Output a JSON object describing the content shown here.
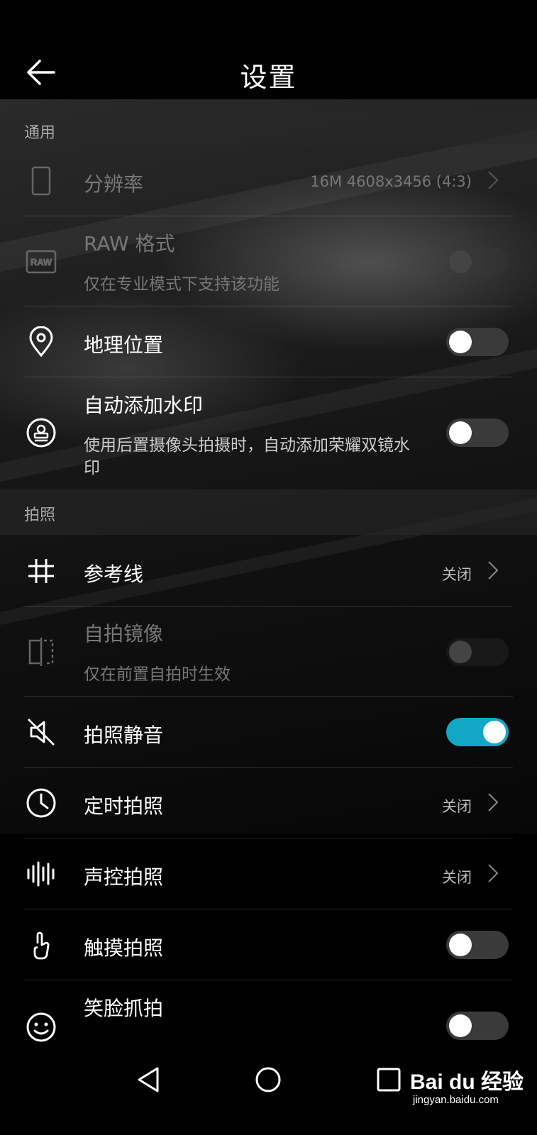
{
  "header": {
    "title": "设置"
  },
  "sections": {
    "general": "通用",
    "photo": "拍照"
  },
  "rows": {
    "resolution": {
      "label": "分辨率",
      "value": "16M 4608x3456 (4:3)"
    },
    "raw": {
      "label": "RAW 格式",
      "sub": "仅在专业模式下支持该功能"
    },
    "location": {
      "label": "地理位置"
    },
    "watermark": {
      "label": "自动添加水印",
      "sub": "使用后置摄像头拍摄时，自动添加荣耀双镜水印"
    },
    "grid": {
      "label": "参考线",
      "value": "关闭"
    },
    "mirror": {
      "label": "自拍镜像",
      "sub": "仅在前置自拍时生效"
    },
    "mute": {
      "label": "拍照静音"
    },
    "timer": {
      "label": "定时拍照",
      "value": "关闭"
    },
    "voice": {
      "label": "声控拍照",
      "value": "关闭"
    },
    "touch": {
      "label": "触摸拍照"
    },
    "smile": {
      "label": "笑脸抓拍"
    }
  },
  "toggles": {
    "raw": "disabled-off",
    "location": "off",
    "watermark": "off",
    "mirror": "disabled-off",
    "mute": "on",
    "touch": "off",
    "smile": "off"
  },
  "colors": {
    "toggle_on": "#13a7c6",
    "background": "#000000"
  },
  "watermark_logo": {
    "main": "Bai du 经验",
    "sub": "jingyan.baidu.com"
  }
}
